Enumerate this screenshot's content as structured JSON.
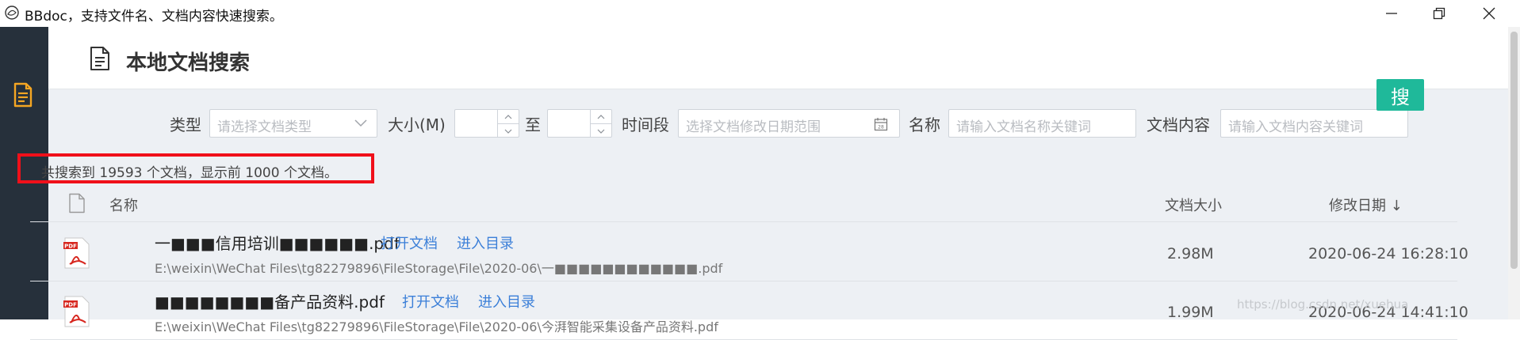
{
  "window": {
    "title": "BBdoc，支持文件名、文档内容快速搜索。",
    "controls": [
      "minimize",
      "maximize",
      "close"
    ]
  },
  "sidebar": {
    "items": [
      {
        "icon": "document-icon",
        "active": true
      }
    ],
    "accent_color": "#f5a623"
  },
  "header": {
    "title": "本地文档搜索"
  },
  "filters": {
    "type_label": "类型",
    "type_placeholder": "请选择文档类型",
    "size_label": "大小(M)",
    "size_to_label": "至",
    "size_min_value": "",
    "size_max_value": "",
    "period_label": "时间段",
    "period_placeholder": "选择文档修改日期范围",
    "name_label": "名称",
    "name_placeholder": "请输入文档名称关键词",
    "content_label": "文档内容",
    "content_placeholder": "请输入文档内容关键词",
    "search_button": "搜"
  },
  "summary": {
    "text": "共搜索到 19593 个文档，显示前 1000 个文档。"
  },
  "table": {
    "columns": {
      "name": "名称",
      "size": "文档大小",
      "date": "修改日期 ↓"
    },
    "rows": [
      {
        "name": "一■■■信用培训■■■■■■.pdf",
        "open_link": "打开文档",
        "dir_link": "进入目录",
        "path": "E:\\weixin\\WeChat Files\\tg82279896\\FileStorage\\File\\2020-06\\一■■■■■■■■■■■■.pdf",
        "size": "2.98M",
        "date": "2020-06-24 16:28:10"
      },
      {
        "name": "■■■■■■■■备产品资料.pdf",
        "open_link": "打开文档",
        "dir_link": "进入目录",
        "path": "E:\\weixin\\WeChat Files\\tg82279896\\FileStorage\\File\\2020-06\\今湃智能采集设备产品资料.pdf",
        "size": "1.99M",
        "date": "2020-06-24 14:41:10"
      }
    ]
  },
  "colors": {
    "accent": "#1fb99a",
    "link": "#3b7fd8",
    "highlight": "#f0101a",
    "sidebar_bg": "#26303b"
  },
  "watermark": "https://blog.csdn.net/xuehua"
}
